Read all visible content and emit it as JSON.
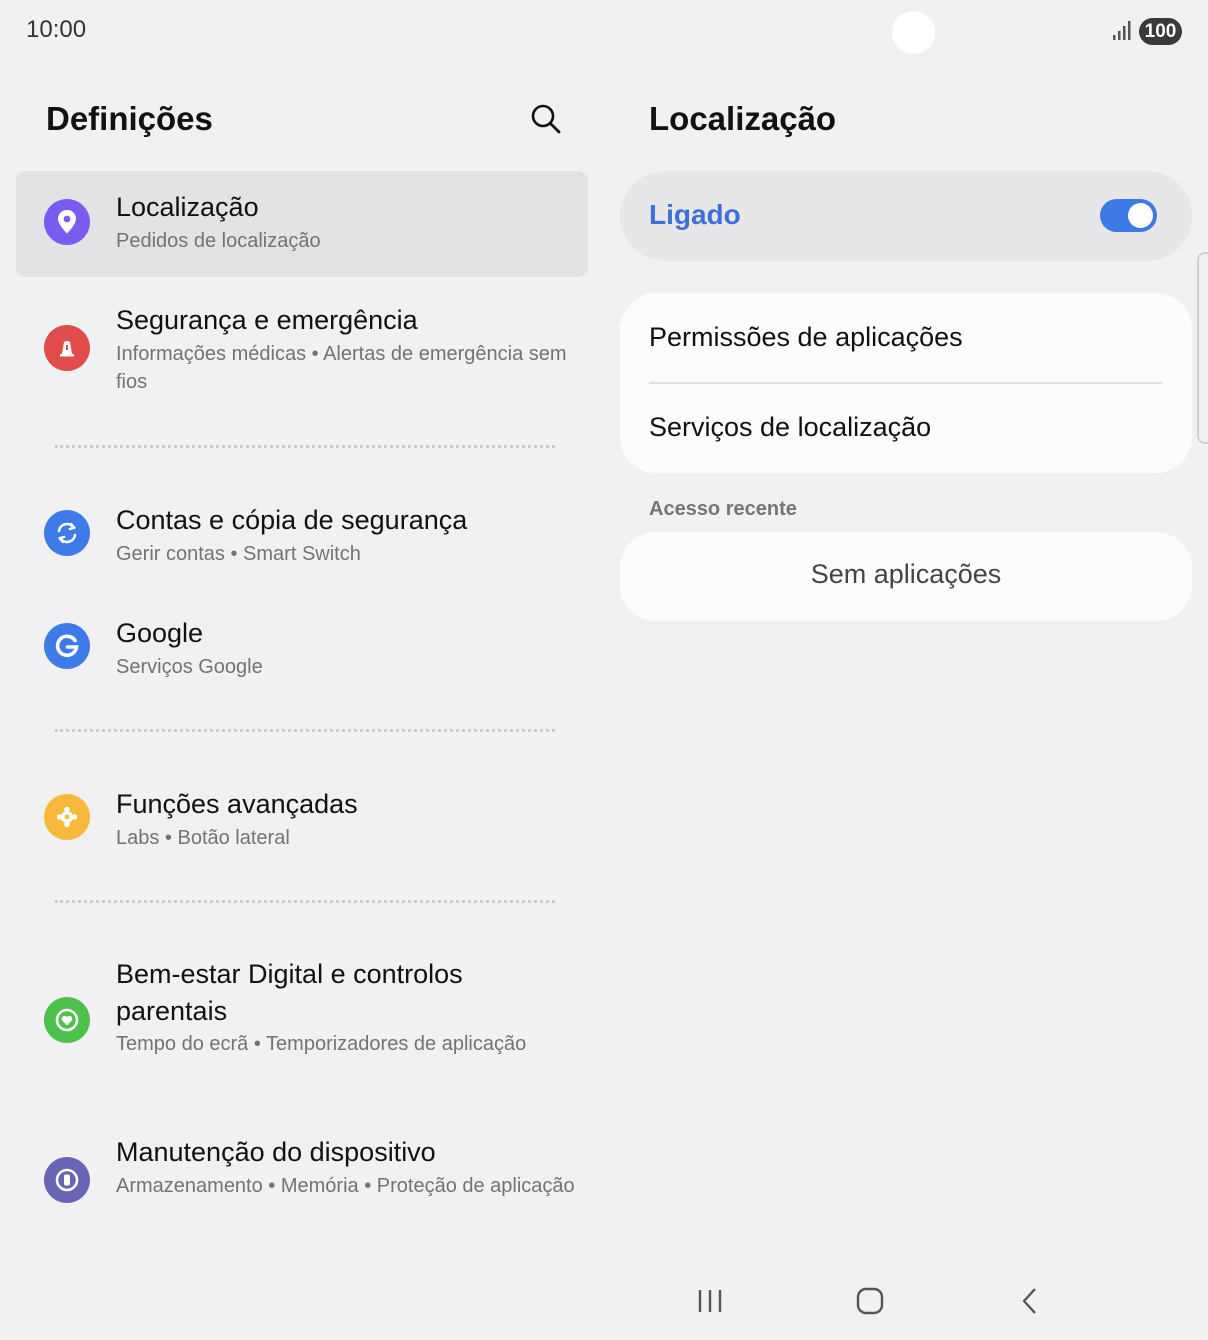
{
  "status_bar": {
    "time": "10:00",
    "battery": "100"
  },
  "left_pane": {
    "title": "Definições",
    "items": [
      {
        "title": "Localização",
        "subtitle": "Pedidos de localização",
        "icon": "location-pin-icon",
        "color": "#7a5cf0"
      },
      {
        "title": "Segurança e emergência",
        "subtitle": "Informações médicas  •  Alertas de emergência sem fios",
        "icon": "emergency-icon",
        "color": "#e04c4c"
      },
      {
        "title": "Contas e cópia de segurança",
        "subtitle": "Gerir contas  •  Smart Switch",
        "icon": "sync-icon",
        "color": "#3d7be8"
      },
      {
        "title": "Google",
        "subtitle": "Serviços Google",
        "icon": "google-icon",
        "color": "#3d7be8"
      },
      {
        "title": "Funções avançadas",
        "subtitle": "Labs  •  Botão lateral",
        "icon": "puzzle-gear-icon",
        "color": "#f6b93b"
      },
      {
        "title": "Bem-estar Digital e controlos parentais",
        "subtitle": "Tempo do ecrã  •  Temporizadores de aplicação",
        "icon": "wellbeing-icon",
        "color": "#4cc24c"
      },
      {
        "title": "Manutenção do dispositivo",
        "subtitle": "Armazenamento  •  Memória  •  Proteção de aplicação",
        "icon": "device-care-icon",
        "color": "#6a64b5"
      }
    ]
  },
  "right_pane": {
    "title": "Localização",
    "toggle": {
      "label": "Ligado",
      "state": "on",
      "accent": "#3e7ae6"
    },
    "options": [
      {
        "label": "Permissões de aplicações"
      },
      {
        "label": "Serviços de localização"
      }
    ],
    "recent_header": "Acesso recente",
    "recent_empty": "Sem aplicações"
  },
  "nav_bar": {
    "icons": [
      "recents-icon",
      "home-icon",
      "back-icon"
    ]
  }
}
